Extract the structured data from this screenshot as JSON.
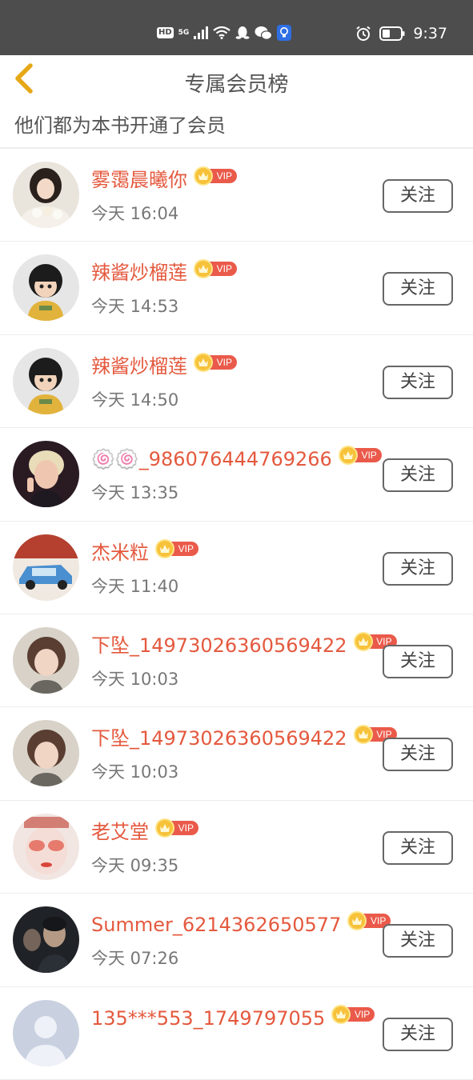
{
  "status_bar": {
    "network_badge": "HD",
    "network_type": "5G",
    "time": "9:37",
    "icons": [
      "hd-icon",
      "signal-icon",
      "wifi-icon",
      "qq-icon",
      "wechat-icon",
      "bulb-icon",
      "alarm-icon",
      "battery-icon"
    ]
  },
  "header": {
    "title": "专属会员榜",
    "subtitle": "他们都为本书开通了会员",
    "back_icon": "chevron-left-icon"
  },
  "vip_badge_label": "VIP",
  "follow_label": "关注",
  "colors": {
    "accent": "#e4593e",
    "status_bar": "#4d4d4d",
    "back_arrow": "#e6a817",
    "vip_pill": "#ea5a4a",
    "vip_crown": "#f7c23a"
  },
  "members": [
    {
      "name": "雾霭晨曦你",
      "time": "今天 16:04",
      "avatar": "girl-with-flowers-avatar"
    },
    {
      "name": "辣酱炒榴莲",
      "time": "今天 14:53",
      "avatar": "cartoon-child-avatar"
    },
    {
      "name": "辣酱炒榴莲",
      "time": "今天 14:50",
      "avatar": "cartoon-child-avatar"
    },
    {
      "name": "🍥🍥_986076444769266",
      "time": "今天 13:35",
      "avatar": "anime-boy-avatar"
    },
    {
      "name": "杰米粒",
      "time": "今天 11:40",
      "avatar": "toy-car-avatar"
    },
    {
      "name": "下坠_14973026360569422",
      "time": "今天 10:03",
      "avatar": "short-hair-girl-avatar"
    },
    {
      "name": "下坠_14973026360569422",
      "time": "今天 10:03",
      "avatar": "short-hair-girl-avatar"
    },
    {
      "name": "老艾堂",
      "time": "今天 09:35",
      "avatar": "red-makeup-face-avatar"
    },
    {
      "name": "Summer_6214362650577",
      "time": "今天 07:26",
      "avatar": "dark-portrait-avatar"
    },
    {
      "name": "135***553_1749797055",
      "time": "",
      "avatar": "default-gray-avatar"
    }
  ]
}
